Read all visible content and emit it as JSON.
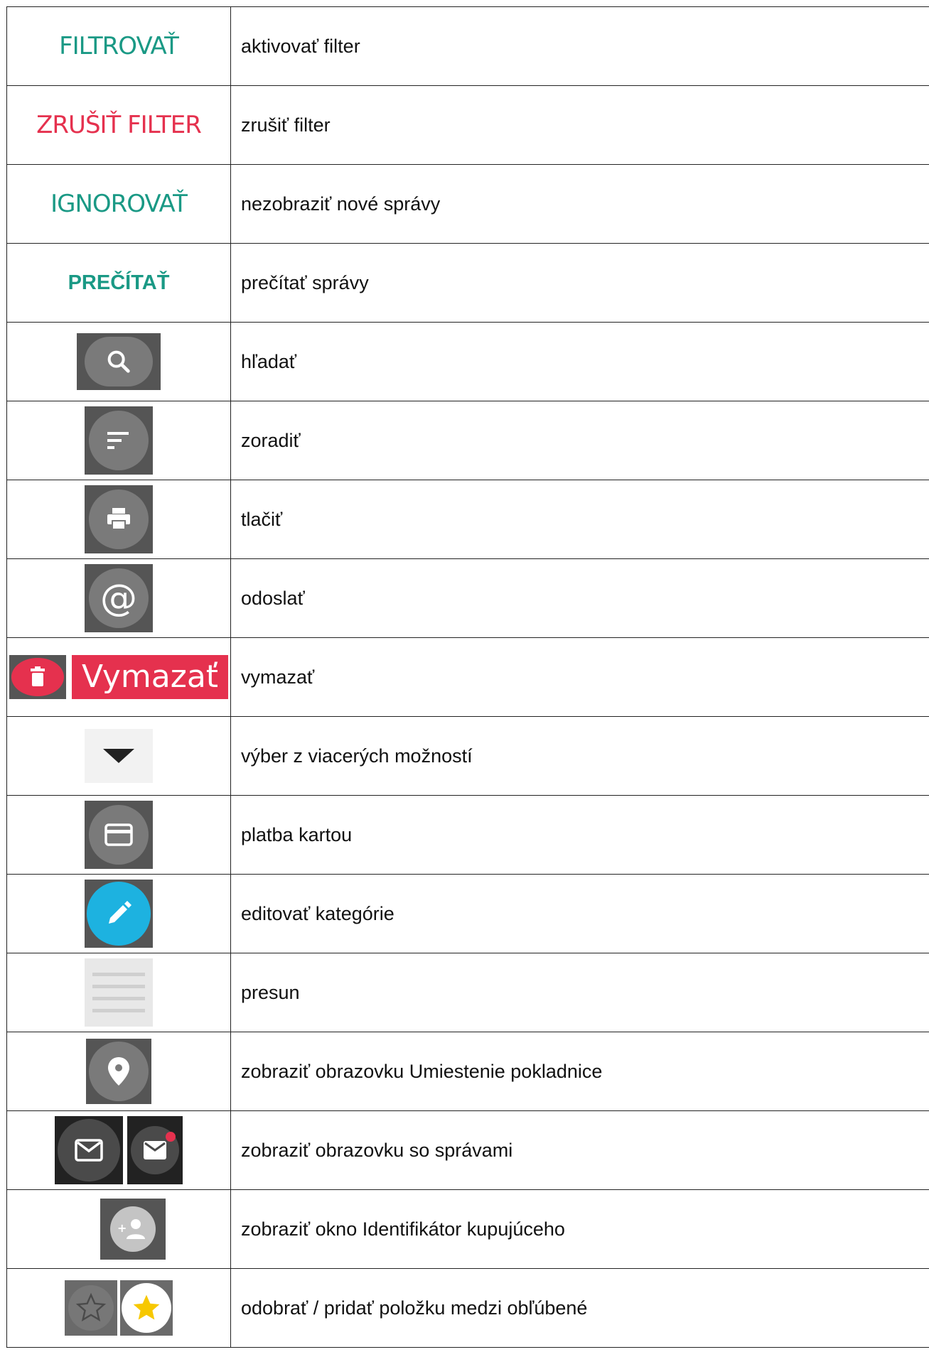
{
  "rows": [
    {
      "control": "FILTROVAŤ",
      "description": "aktivovať filter"
    },
    {
      "control": "ZRUŠIŤ FILTER",
      "description": "zrušiť filter"
    },
    {
      "control": "IGNOROVAŤ",
      "description": "nezobraziť nové správy"
    },
    {
      "control": "PREČÍTAŤ",
      "description": "prečítať správy"
    },
    {
      "icon": "search-icon",
      "description": "hľadať"
    },
    {
      "icon": "sort-icon",
      "description": "zoradiť"
    },
    {
      "icon": "print-icon",
      "description": "tlačiť"
    },
    {
      "icon": "at-icon",
      "description": "odoslať"
    },
    {
      "icon": "trash-icon",
      "control": "Vymazať",
      "description": "vymazať"
    },
    {
      "icon": "dropdown-arrow-icon",
      "description": "výber z viacerých možností"
    },
    {
      "icon": "credit-card-icon",
      "description": "platba kartou"
    },
    {
      "icon": "pencil-icon",
      "description": "editovať kategórie"
    },
    {
      "icon": "drag-handle-icon",
      "description": "presun"
    },
    {
      "icon": "location-pin-icon",
      "description": "zobraziť obrazovku Umiestenie pokladnice"
    },
    {
      "icon": "mail-icon",
      "description": "zobraziť obrazovku so správami"
    },
    {
      "icon": "add-person-icon",
      "description": "zobraziť okno Identifikátor kupujúceho"
    },
    {
      "icon": "star-icon",
      "description": "odobrať / pridať položku medzi obľúbené"
    }
  ],
  "colors": {
    "teal": "#1a9985",
    "red": "#e5314e",
    "dark_icon_bg": "#555555",
    "blue": "#1db2e0",
    "yellow": "#f7c800"
  }
}
